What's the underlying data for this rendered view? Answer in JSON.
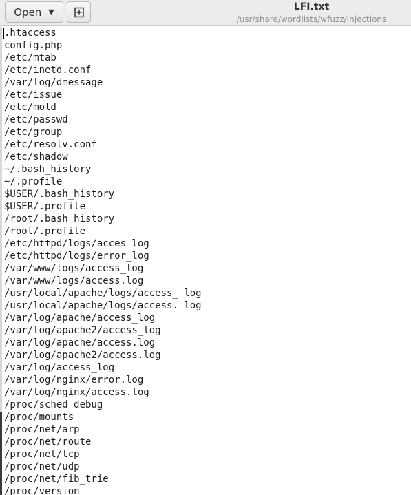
{
  "toolbar": {
    "open_label": "Open",
    "open_icon": "chevron-down-icon",
    "new_icon": "new-document-icon"
  },
  "window": {
    "title": "LFI.txt",
    "subtitle": "/usr/share/wordlists/wfuzz/Injections"
  },
  "editor": {
    "lines": [
      ".htaccess",
      "config.php",
      "/etc/mtab",
      "/etc/inetd.conf",
      "/var/log/dmessage",
      "/etc/issue",
      "/etc/motd",
      "/etc/passwd",
      "/etc/group",
      "/etc/resolv.conf",
      "/etc/shadow",
      "~/.bash_history",
      "~/.profile",
      "$USER/.bash_history",
      "$USER/.profile",
      "/root/.bash_history",
      "/root/.profile",
      "/etc/httpd/logs/acces_log",
      "/etc/httpd/logs/error_log",
      "/var/www/logs/access_log",
      "/var/www/logs/access.log",
      "/usr/local/apache/logs/access_ log",
      "/usr/local/apache/logs/access. log",
      "/var/log/apache/access_log",
      "/var/log/apache2/access_log",
      "/var/log/apache/access.log",
      "/var/log/apache2/access.log",
      "/var/log/access_log",
      "/var/log/nginx/error.log",
      "/var/log/nginx/access.log",
      "/proc/sched_debug",
      "/proc/mounts",
      "/proc/net/arp",
      "/proc/net/route",
      "/proc/net/tcp",
      "/proc/net/udp",
      "/proc/net/fib_trie",
      "/proc/version"
    ]
  }
}
